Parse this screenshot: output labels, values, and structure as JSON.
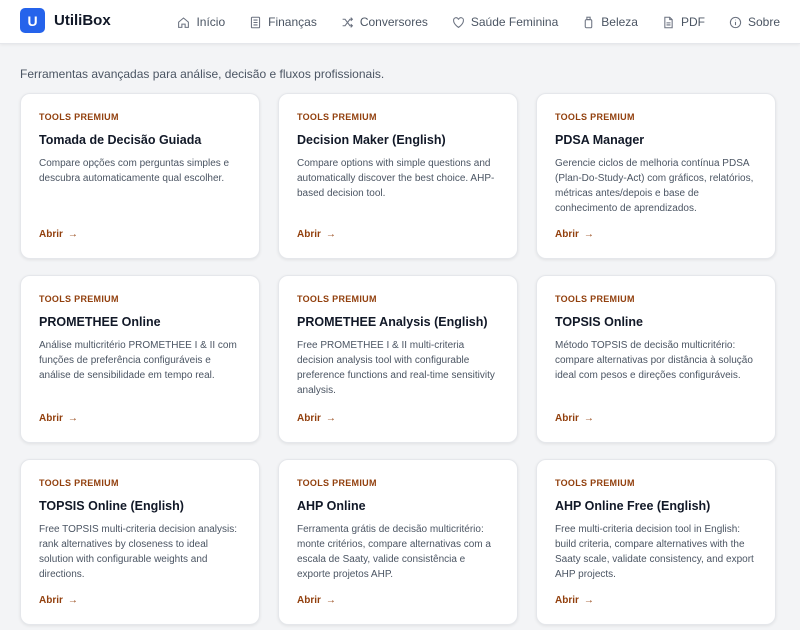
{
  "brand": {
    "logo_letter": "U",
    "name": "UtiliBox",
    "accent": "#2563eb"
  },
  "nav": [
    {
      "label": "Início",
      "icon": "home-icon"
    },
    {
      "label": "Finanças",
      "icon": "document-icon"
    },
    {
      "label": "Conversores",
      "icon": "shuffle-icon"
    },
    {
      "label": "Saúde Feminina",
      "icon": "heart-icon"
    },
    {
      "label": "Beleza",
      "icon": "bottle-icon"
    },
    {
      "label": "PDF",
      "icon": "file-icon"
    },
    {
      "label": "Sobre",
      "icon": "info-icon"
    }
  ],
  "subtitle": "Ferramentas avançadas para análise, decisão e fluxos profissionais.",
  "tag_color": "#92400e",
  "cards": [
    {
      "tag": "TOOLS PREMIUM",
      "title": "Tomada de Decisão Guiada",
      "desc": "Compare opções com perguntas simples e descubra automaticamente qual escolher.",
      "link": "Abrir"
    },
    {
      "tag": "TOOLS PREMIUM",
      "title": "Decision Maker (English)",
      "desc": "Compare options with simple questions and automatically discover the best choice. AHP-based decision tool.",
      "link": "Abrir"
    },
    {
      "tag": "TOOLS PREMIUM",
      "title": "PDSA Manager",
      "desc": "Gerencie ciclos de melhoria contínua PDSA (Plan-Do-Study-Act) com gráficos, relatórios, métricas antes/depois e base de conhecimento de aprendizados.",
      "link": "Abrir"
    },
    {
      "tag": "TOOLS PREMIUM",
      "title": "PROMETHEE Online",
      "desc": "Análise multicritério PROMETHEE I & II com funções de preferência configuráveis e análise de sensibilidade em tempo real.",
      "link": "Abrir"
    },
    {
      "tag": "TOOLS PREMIUM",
      "title": "PROMETHEE Analysis (English)",
      "desc": "Free PROMETHEE I & II multi-criteria decision analysis tool with configurable preference functions and real-time sensitivity analysis.",
      "link": "Abrir"
    },
    {
      "tag": "TOOLS PREMIUM",
      "title": "TOPSIS Online",
      "desc": "Método TOPSIS de decisão multicritério: compare alternativas por distância à solução ideal com pesos e direções configuráveis.",
      "link": "Abrir"
    },
    {
      "tag": "TOOLS PREMIUM",
      "title": "TOPSIS Online (English)",
      "desc": "Free TOPSIS multi-criteria decision analysis: rank alternatives by closeness to ideal solution with configurable weights and directions.",
      "link": "Abrir"
    },
    {
      "tag": "TOOLS PREMIUM",
      "title": "AHP Online",
      "desc": "Ferramenta grátis de decisão multicritério: monte critérios, compare alternativas com a escala de Saaty, valide consistência e exporte projetos AHP.",
      "link": "Abrir"
    },
    {
      "tag": "TOOLS PREMIUM",
      "title": "AHP Online Free (English)",
      "desc": "Free multi-criteria decision tool in English: build criteria, compare alternatives with the Saaty scale, validate consistency, and export AHP projects.",
      "link": "Abrir"
    }
  ]
}
